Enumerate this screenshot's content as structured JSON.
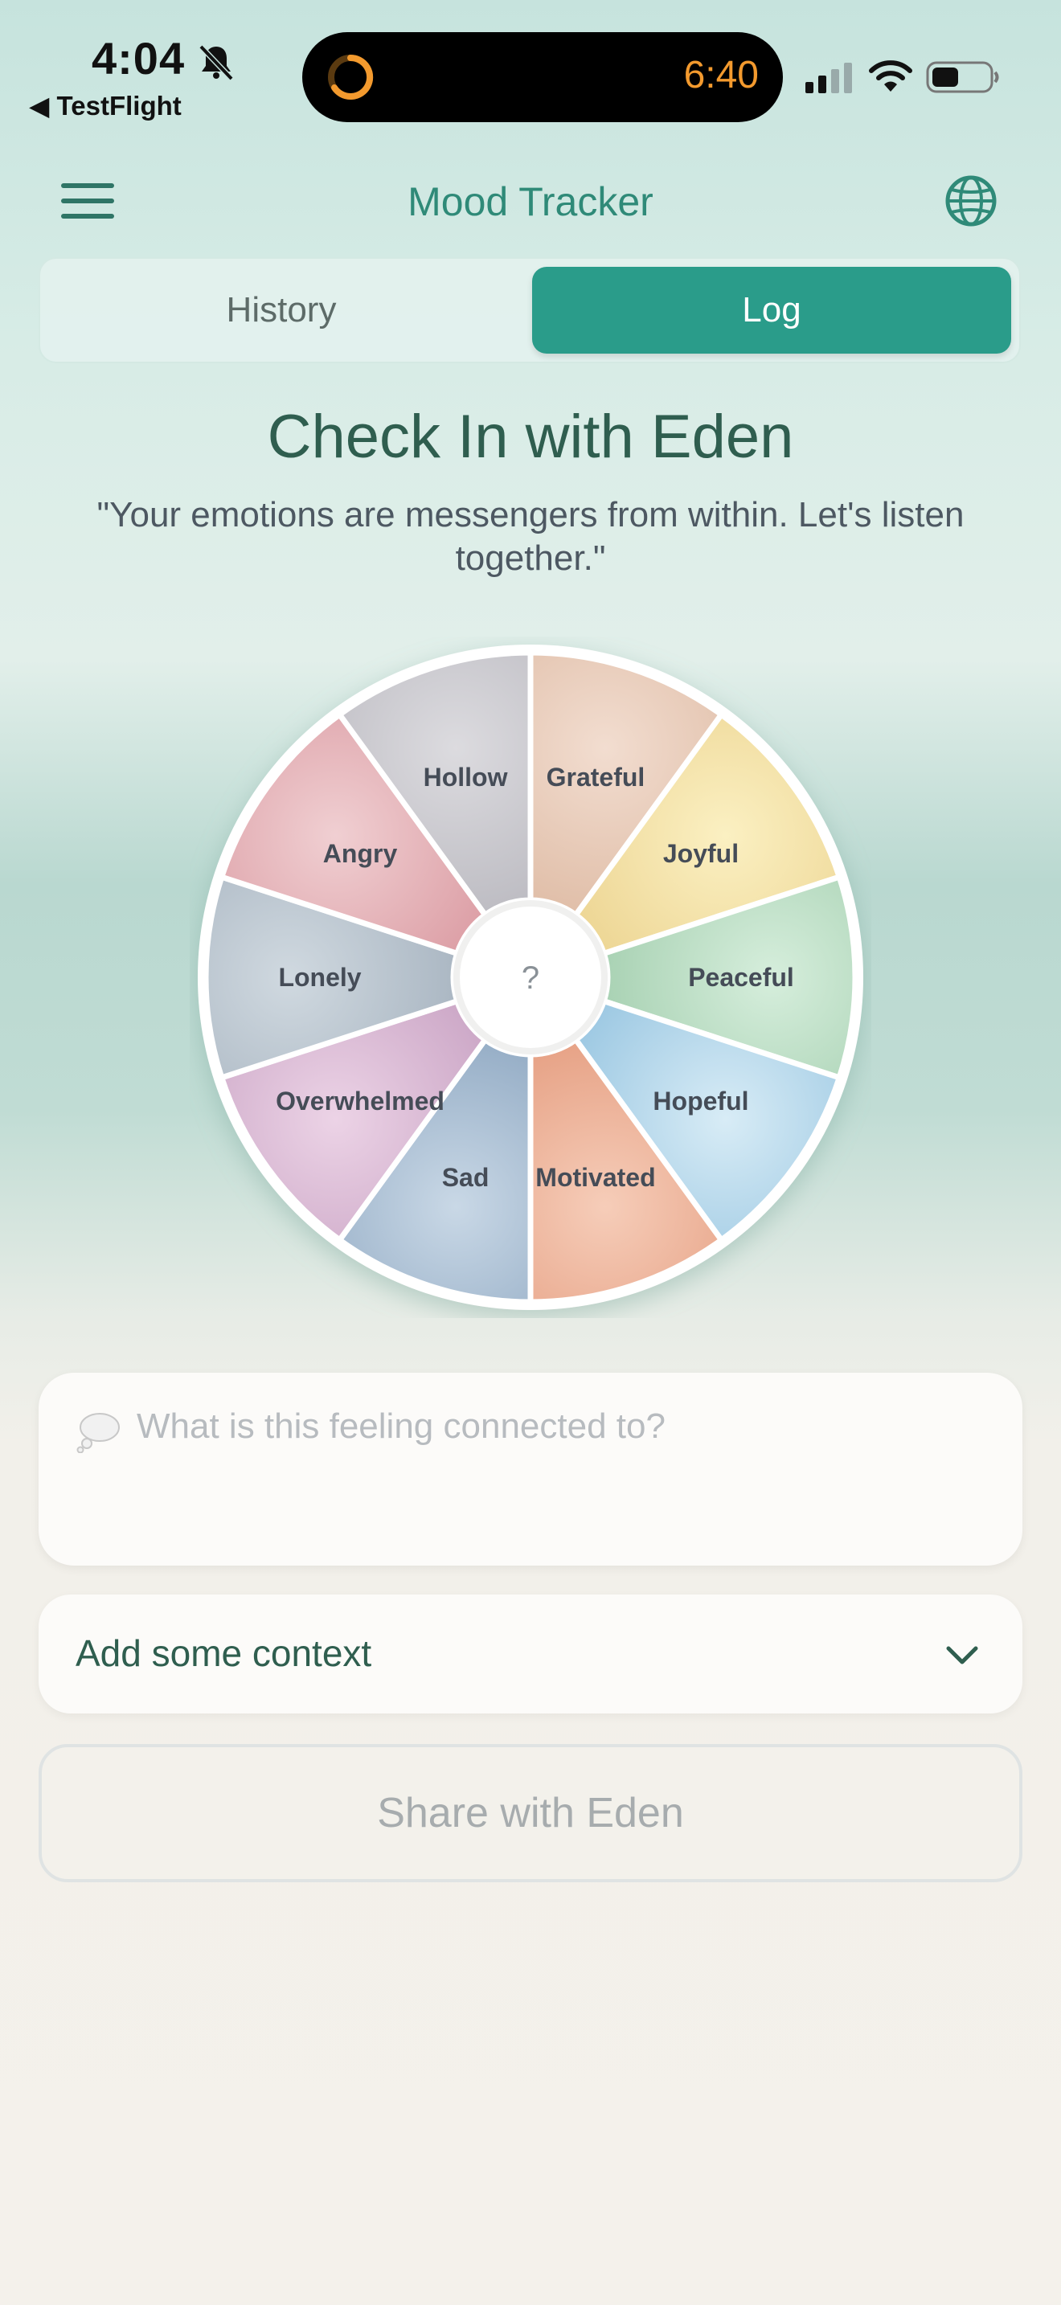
{
  "status_bar": {
    "time": "4:04",
    "back_app": "◀ TestFlight",
    "timer": "6:40",
    "icons": [
      "bell-slash-icon",
      "activity-ring-icon",
      "signal-icon",
      "wifi-icon",
      "battery-icon"
    ]
  },
  "header": {
    "title": "Mood Tracker",
    "menu_icon": "hamburger-menu-icon",
    "globe_icon": "globe-icon"
  },
  "tabs": {
    "history": "History",
    "log": "Log",
    "active": "log"
  },
  "main": {
    "title": "Check In with Eden",
    "quote": "\"Your emotions are messengers from within. Let's listen together.\""
  },
  "wheel": {
    "center_label": "?",
    "segments": [
      {
        "label": "Grateful",
        "color_light": "#f2ddd0",
        "color_dark": "#dcb79f"
      },
      {
        "label": "Joyful",
        "color_light": "#fbf0c2",
        "color_dark": "#ead08a"
      },
      {
        "label": "Peaceful",
        "color_light": "#d6eedc",
        "color_dark": "#9ecbaa"
      },
      {
        "label": "Hopeful",
        "color_light": "#d8ecf6",
        "color_dark": "#8fc0de"
      },
      {
        "label": "Motivated",
        "color_light": "#f6cdb9",
        "color_dark": "#e3987a"
      },
      {
        "label": "Sad",
        "color_light": "#c9d8e6",
        "color_dark": "#8aa4bf"
      },
      {
        "label": "Overwhelmed",
        "color_light": "#ecd3e6",
        "color_dark": "#c59ec0"
      },
      {
        "label": "Lonely",
        "color_light": "#d0d9e0",
        "color_dark": "#a2afbc"
      },
      {
        "label": "Angry",
        "color_light": "#f0cfd2",
        "color_dark": "#d8949c"
      },
      {
        "label": "Hollow",
        "color_light": "#dcdbdf",
        "color_dark": "#b6b5bc"
      }
    ]
  },
  "note": {
    "placeholder": "What is this feeling connected to?",
    "icon": "thought-bubble-icon"
  },
  "context": {
    "label": "Add some context",
    "icon": "chevron-down-icon"
  },
  "share": {
    "label": "Share with Eden"
  },
  "colors": {
    "accent": "#2a9c8a",
    "title": "#2f5e4f",
    "timer": "#f39a2e"
  }
}
